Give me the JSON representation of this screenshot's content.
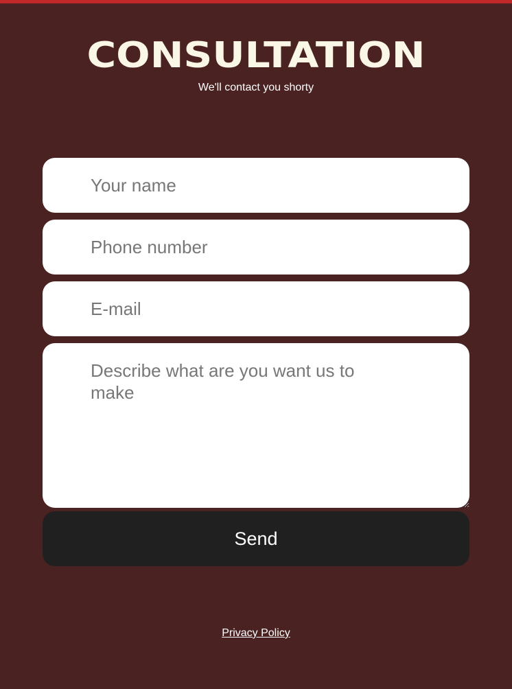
{
  "colors": {
    "background": "#4a2222",
    "accent_bar": "#c0282a",
    "title_text": "#fbf7e6",
    "field_background": "#ffffff",
    "placeholder_text": "#777777",
    "button_background": "#202020",
    "button_text": "#ffffff"
  },
  "header": {
    "title": "CONSULTATION",
    "subtitle": "We'll contact you shorty"
  },
  "form": {
    "name_placeholder": "Your name",
    "phone_placeholder": "Phone number",
    "email_placeholder": "E-mail",
    "message_placeholder": "Describe what are you want us to make",
    "send_label": "Send"
  },
  "footer": {
    "privacy_label": "Privacy Policy"
  }
}
